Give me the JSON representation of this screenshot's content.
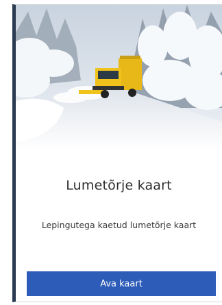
{
  "card": {
    "title": "Lumetõrje kaart",
    "description": "Lepingutega kaetud lumetõrje kaart",
    "button_label": "Ava kaart",
    "image": "snowplow-truck-winter-road-photo"
  },
  "colors": {
    "button_bg": "#2c5bb8",
    "card_accent": "#2a3b52"
  }
}
